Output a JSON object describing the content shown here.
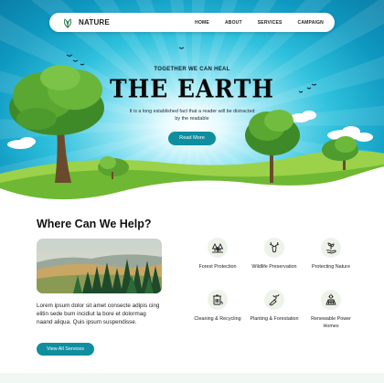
{
  "nav": {
    "brand": "NATURE",
    "links": [
      "HOME",
      "ABOUT",
      "SERVICES",
      "CAMPAIGN"
    ]
  },
  "hero": {
    "eyebrow": "TOGETHER WE CAN HEAL",
    "title": "THE EARTH",
    "description": "It is a long established fact that a reader will be distracted by the readable",
    "button": "Read More"
  },
  "help": {
    "title": "Where Can We Help?",
    "body": "Lorem ipsum dolor sit amet consecte adipis cing elitin sede bum incidiut la bore et dolormag naand aliqua. Quis ipsum suspendisse.",
    "button": "View All Services",
    "services": [
      {
        "label": "Forest Protection",
        "icon": "forest-icon"
      },
      {
        "label": "Wildlife Preservation",
        "icon": "deer-icon"
      },
      {
        "label": "Protecting Nature",
        "icon": "plant-hand-icon"
      },
      {
        "label": "Cleaning & Recycling",
        "icon": "recycle-icon"
      },
      {
        "label": "Planting & Forestation",
        "icon": "planting-icon"
      },
      {
        "label": "Renewable Power Homes",
        "icon": "solar-icon"
      }
    ]
  },
  "colors": {
    "accent": "#0f8ea0",
    "sky": "#2fc1dd",
    "grass": "#7cc242",
    "icon_bg": "#eef3ea"
  }
}
